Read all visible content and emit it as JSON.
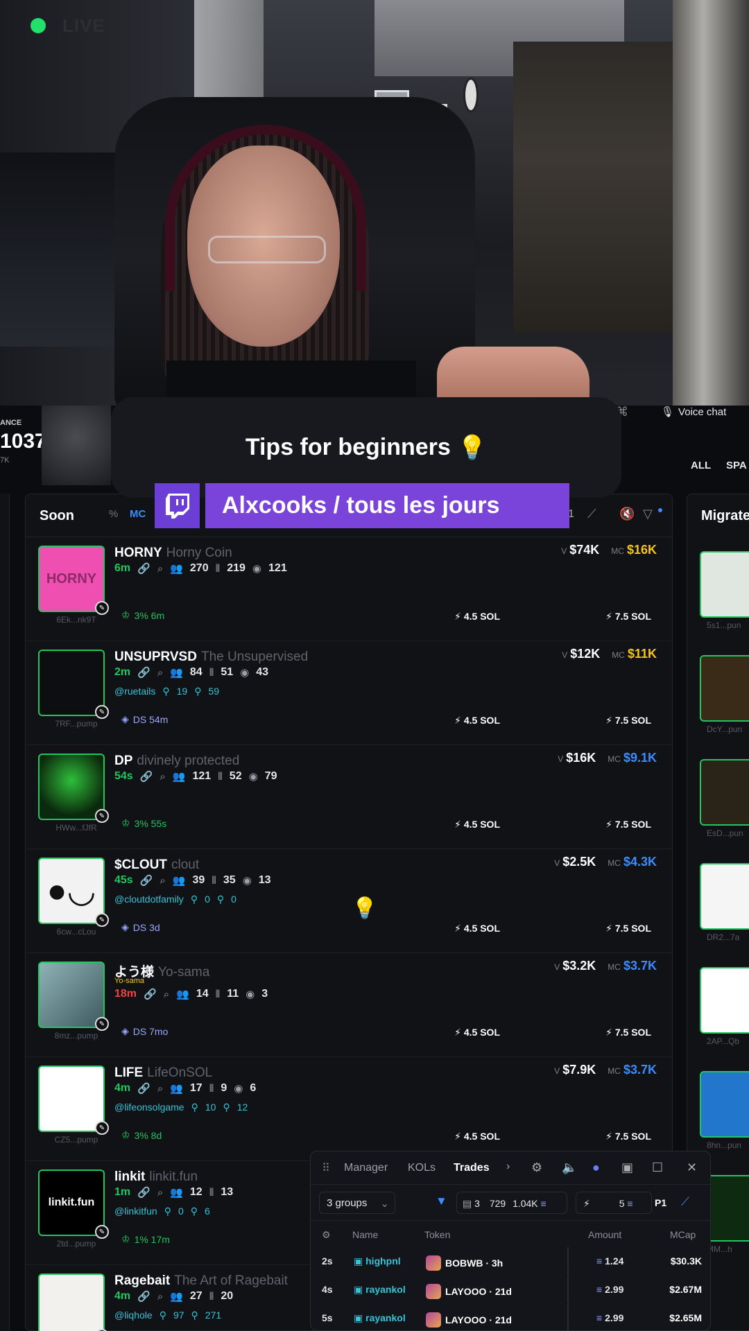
{
  "stream": {
    "live_label": "LIVE",
    "tips_text": "Tips for beginners",
    "tips_icon": "💡",
    "twitch_text": "Alxcooks / tous les jours",
    "twitch_color": "#7a43d9"
  },
  "topbar": {
    "balance_label": "ANCE",
    "balance_value": "1037",
    "balance_sub": "7K",
    "voice_chat": "Voice chat",
    "filter_all": "ALL",
    "filter_spark": "SPA"
  },
  "column": {
    "title": "Soon",
    "chip_pct": "%",
    "chip_mc": "MC",
    "page": "1",
    "rows": [
      {
        "ticker": "HORNY",
        "name": "Horny Coin",
        "age": "6m",
        "holders": "270",
        "trades": "219",
        "views": "121",
        "social_handle": "",
        "social_a": "",
        "social_b": "",
        "tag": "3% 6m",
        "addr": "6Ek...nk9T",
        "v": "$74K",
        "mc": "$16K",
        "buy1": "4.5 SOL",
        "buy2": "7.5 SOL",
        "thumb_text": "HORNY"
      },
      {
        "ticker": "UNSUPRVSD",
        "name": "The Unsupervised",
        "age": "2m",
        "holders": "84",
        "trades": "51",
        "views": "43",
        "social_handle": "@ruetails",
        "social_a": "19",
        "social_b": "59",
        "tag": "DS 54m",
        "addr": "7RF...pump",
        "v": "$12K",
        "mc": "$11K",
        "buy1": "4.5 SOL",
        "buy2": "7.5 SOL",
        "thumb_text": ""
      },
      {
        "ticker": "DP",
        "name": "divinely protected",
        "age": "54s",
        "holders": "121",
        "trades": "52",
        "views": "79",
        "social_handle": "",
        "social_a": "",
        "social_b": "",
        "tag": "3% 55s",
        "addr": "HWw...fJfR",
        "v": "$16K",
        "mc": "$9.1K",
        "buy1": "4.5 SOL",
        "buy2": "7.5 SOL",
        "thumb_text": ""
      },
      {
        "ticker": "$CLOUT",
        "name": "clout",
        "age": "45s",
        "holders": "39",
        "trades": "35",
        "views": "13",
        "social_handle": "@cloutdotfamily",
        "social_a": "0",
        "social_b": "0",
        "tag": "DS 3d",
        "addr": "6cw...cLou",
        "v": "$2.5K",
        "mc": "$4.3K",
        "buy1": "4.5 SOL",
        "buy2": "7.5 SOL",
        "thumb_text": "●◡"
      },
      {
        "ticker": "よう様",
        "name": "Yo-sama",
        "sub": "Yo-sama",
        "age": "18m",
        "holders": "14",
        "trades": "11",
        "views": "3",
        "social_handle": "",
        "social_a": "",
        "social_b": "",
        "tag": "DS 7mo",
        "addr": "8mz...pump",
        "v": "$3.2K",
        "mc": "$3.7K",
        "buy1": "4.5 SOL",
        "buy2": "7.5 SOL",
        "thumb_text": ""
      },
      {
        "ticker": "LIFE",
        "name": "LifeOnSOL",
        "age": "4m",
        "holders": "17",
        "trades": "9",
        "views": "6",
        "social_handle": "@lifeonsolgame",
        "social_a": "10",
        "social_b": "12",
        "tag": "3% 8d",
        "addr": "CZ5...pump",
        "v": "$7.9K",
        "mc": "$3.7K",
        "buy1": "4.5 SOL",
        "buy2": "7.5 SOL",
        "thumb_text": ""
      },
      {
        "ticker": "linkit",
        "name": "linkit.fun",
        "age": "1m",
        "holders": "12",
        "trades": "13",
        "views": "",
        "social_handle": "@linkitfun",
        "social_a": "0",
        "social_b": "6",
        "tag": "1% 17m",
        "addr": "2td...pump",
        "v": "",
        "mc": "",
        "buy1": "",
        "buy2": "",
        "thumb_text": "linkit.fun"
      },
      {
        "ticker": "Ragebait",
        "name": "The Art of Ragebait",
        "age": "4m",
        "holders": "27",
        "trades": "20",
        "views": "",
        "social_handle": "@liqhole",
        "social_a": "97",
        "social_b": "271",
        "tag": "",
        "addr": "",
        "v": "",
        "mc": "",
        "buy1": "",
        "buy2": "",
        "thumb_text": ""
      }
    ],
    "v_label": "V",
    "mc_label": "MC"
  },
  "side": {
    "title": "Migrate",
    "addrs": [
      "5s1...pun",
      "DcY...pun",
      "EsD...pun",
      "DR2...7a",
      "2AP...Qb",
      "8hn...pun",
      "MM...h"
    ]
  },
  "panel": {
    "tabs": [
      "Manager",
      "KOLs",
      "Trades"
    ],
    "groups": "3 groups",
    "stat_count": "3",
    "stat_txs": "729",
    "stat_vol": "1.04K",
    "bolt_value": "5",
    "page": "P1",
    "headers": {
      "name": "Name",
      "token": "Token",
      "amount": "Amount",
      "mcap": "MCap"
    },
    "trades": [
      {
        "age": "2s",
        "user": "highpnl",
        "token": "BOBWB · 3h",
        "amount": "1.24",
        "mcap": "$30.3K"
      },
      {
        "age": "4s",
        "user": "rayankol",
        "token": "LAYOOO · 21d",
        "amount": "2.99",
        "mcap": "$2.67M"
      },
      {
        "age": "5s",
        "user": "rayankol",
        "token": "LAYOOO · 21d",
        "amount": "2.99",
        "mcap": "$2.65M"
      }
    ]
  }
}
